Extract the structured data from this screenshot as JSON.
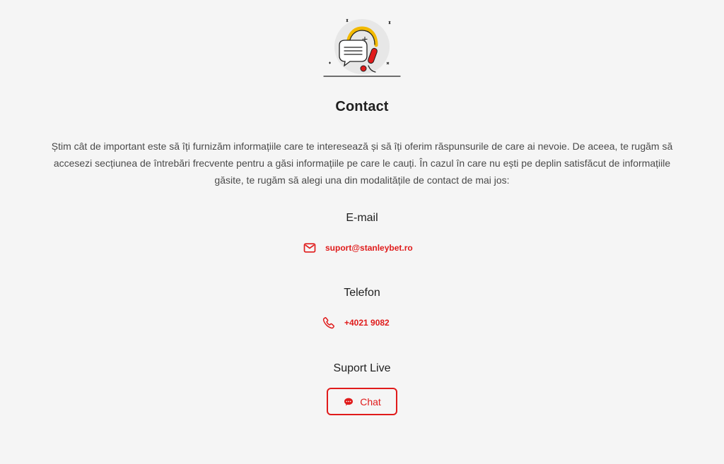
{
  "page": {
    "title": "Contact",
    "intro": "Știm cât de important este să îți furnizăm informațiile care te interesează și să îți oferim răspunsurile de care ai nevoie. De aceea, te rugăm să accesezi secțiunea de întrebări frecvente pentru a găsi informațiile pe care le cauți. În cazul în care nu ești pe deplin satisfăcut de informațiile găsite, te rugăm să alegi una din modalitățile de contact de mai jos:"
  },
  "sections": {
    "email": {
      "title": "E-mail",
      "value": "suport@stanleybet.ro",
      "icon": "mail-icon"
    },
    "phone": {
      "title": "Telefon",
      "value": "+4021 9082",
      "icon": "phone-icon"
    },
    "live": {
      "title": "Suport Live",
      "button_label": "Chat",
      "icon": "chat-bubble-icon"
    }
  },
  "colors": {
    "accent": "#e01b1b",
    "background": "#f5f5f5",
    "text": "#1f1f1f",
    "muted_text": "#4a4a4a"
  }
}
